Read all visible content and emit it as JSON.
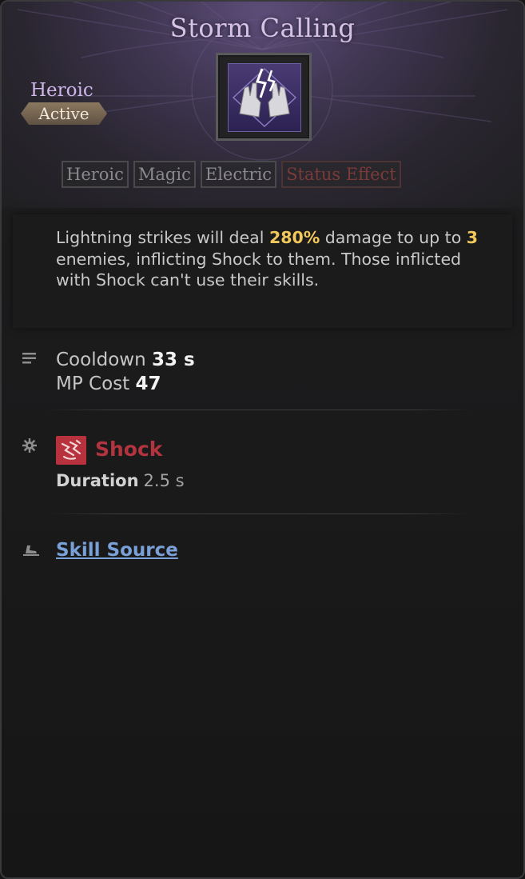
{
  "skill": {
    "title": "Storm Calling",
    "rarity": "Heroic",
    "type": "Active",
    "icon": "lightning-hands-icon"
  },
  "tags": [
    {
      "label": "Heroic"
    },
    {
      "label": "Magic"
    },
    {
      "label": "Electric"
    },
    {
      "label": "Status Effect"
    }
  ],
  "description": {
    "part1": "Lightning strikes will deal ",
    "damage": "280%",
    "part2": " damage to up to ",
    "targets": "3",
    "part3": " enemies, inflicting Shock to them. Those inflicted with Shock can't use their skills."
  },
  "stats": {
    "cooldown_label": "Cooldown",
    "cooldown_value": "33 s",
    "mp_label": "MP Cost",
    "mp_value": "47"
  },
  "effect": {
    "name": "Shock",
    "duration_label": "Duration",
    "duration_value": "2.5 s"
  },
  "source": {
    "label": "Skill Source"
  },
  "colors": {
    "rarity": "#cfb6ea",
    "highlight": "#f2c85a",
    "shock": "#b3343e",
    "link": "#7aa0d8"
  }
}
